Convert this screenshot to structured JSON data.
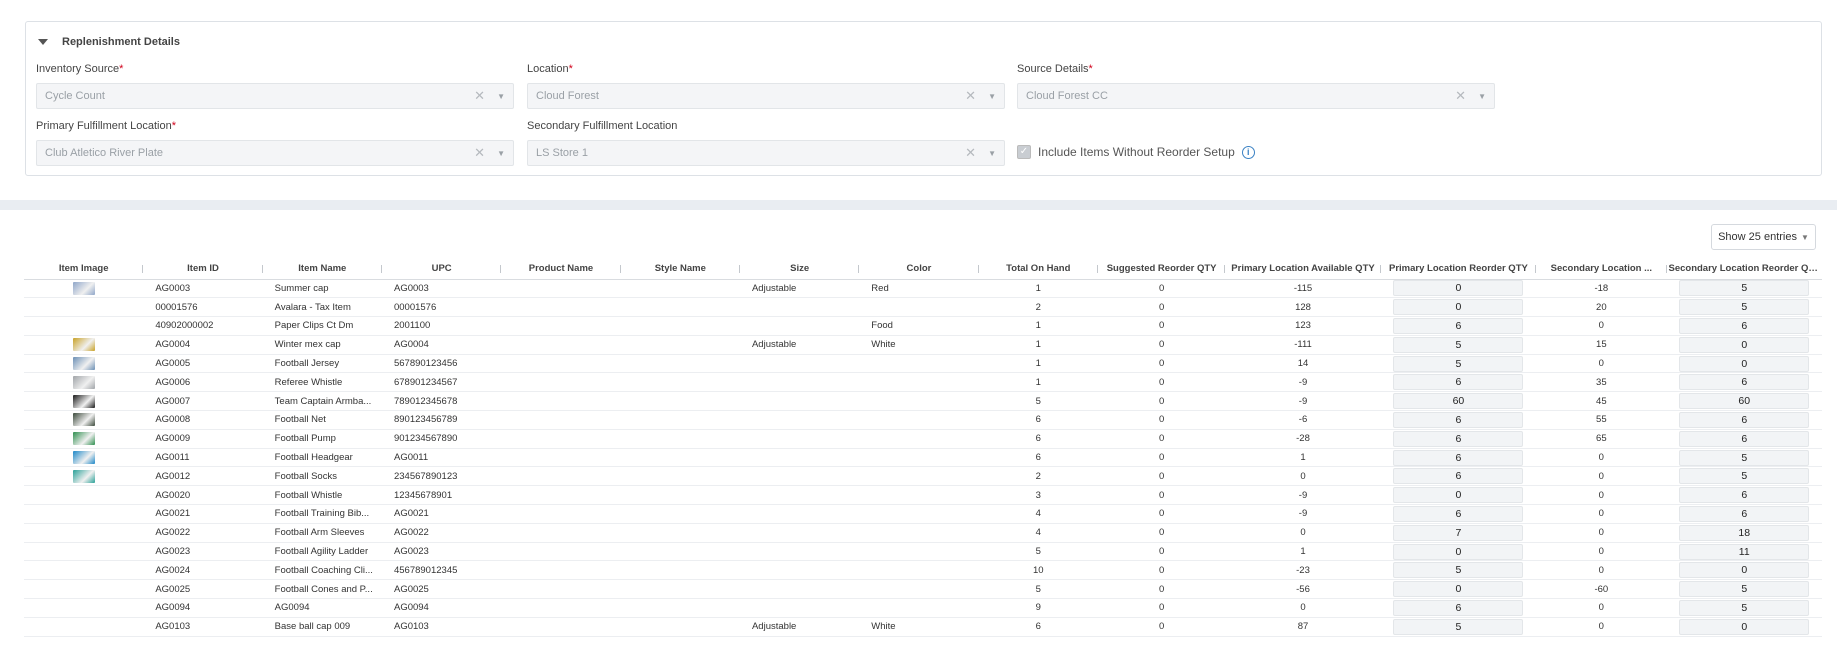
{
  "panel": {
    "title": "Replenishment Details",
    "inventory_source": {
      "label": "Inventory Source",
      "value": "Cycle Count"
    },
    "location": {
      "label": "Location",
      "value": "Cloud Forest"
    },
    "source_details": {
      "label": "Source Details",
      "value": "Cloud Forest CC"
    },
    "primary_location": {
      "label": "Primary Fulfillment Location",
      "value": "Club Atletico River Plate"
    },
    "secondary_location": {
      "label": "Secondary Fulfillment Location",
      "value": "LS Store 1"
    },
    "include_items": {
      "label": "Include Items Without Reorder Setup",
      "checked": true
    },
    "required_mark": "*"
  },
  "table": {
    "entries_label": "Show 25 entries",
    "columns": [
      "Item Image",
      "Item ID",
      "Item Name",
      "UPC",
      "Product Name",
      "Style Name",
      "Size",
      "Color",
      "Total On Hand",
      "Suggested Reorder QTY",
      "Primary Location Available QTY",
      "Primary Location Reorder QTY",
      "Secondary Location ...",
      "Secondary Location Reorder QTY"
    ],
    "rows": [
      {
        "image": "summer-cap",
        "color_swatch": "#8fa6c9",
        "item_id": "AG0003",
        "item_name": "Summer cap",
        "upc": "AG0003",
        "product_name": "",
        "style_name": "",
        "size": "Adjustable",
        "color": "Red",
        "total": "1",
        "suggested": "0",
        "primary_avail": "-115",
        "primary_reorder": "0",
        "secondary_avail": "-18",
        "secondary_reorder": "5"
      },
      {
        "image": "",
        "color_swatch": "",
        "item_id": "00001576",
        "item_name": "Avalara - Tax Item",
        "upc": "00001576",
        "product_name": "",
        "style_name": "",
        "size": "",
        "color": "",
        "total": "2",
        "suggested": "0",
        "primary_avail": "128",
        "primary_reorder": "0",
        "secondary_avail": "20",
        "secondary_reorder": "5"
      },
      {
        "image": "",
        "color_swatch": "",
        "item_id": "40902000002",
        "item_name": "Paper Clips Ct Dm",
        "upc": "2001100",
        "product_name": "",
        "style_name": "",
        "size": "",
        "color": "Food",
        "total": "1",
        "suggested": "0",
        "primary_avail": "123",
        "primary_reorder": "6",
        "secondary_avail": "0",
        "secondary_reorder": "6"
      },
      {
        "image": "winter-cap",
        "color_swatch": "#c9a227",
        "item_id": "AG0004",
        "item_name": "Winter mex cap",
        "upc": "AG0004",
        "product_name": "",
        "style_name": "",
        "size": "Adjustable",
        "color": "White",
        "total": "1",
        "suggested": "0",
        "primary_avail": "-111",
        "primary_reorder": "5",
        "secondary_avail": "15",
        "secondary_reorder": "0"
      },
      {
        "image": "football-jersey",
        "color_swatch": "#6b8fb5",
        "item_id": "AG0005",
        "item_name": "Football Jersey",
        "upc": "567890123456",
        "product_name": "",
        "style_name": "",
        "size": "",
        "color": "",
        "total": "1",
        "suggested": "0",
        "primary_avail": "14",
        "primary_reorder": "5",
        "secondary_avail": "0",
        "secondary_reorder": "0"
      },
      {
        "image": "referee-whistle",
        "color_swatch": "#a0a4a8",
        "item_id": "AG0006",
        "item_name": "Referee Whistle",
        "upc": "678901234567",
        "product_name": "",
        "style_name": "",
        "size": "",
        "color": "",
        "total": "1",
        "suggested": "0",
        "primary_avail": "-9",
        "primary_reorder": "6",
        "secondary_avail": "35",
        "secondary_reorder": "6"
      },
      {
        "image": "captain-armband",
        "color_swatch": "#1a1a1a",
        "item_id": "AG0007",
        "item_name": "Team Captain Armba...",
        "upc": "789012345678",
        "product_name": "",
        "style_name": "",
        "size": "",
        "color": "",
        "total": "5",
        "suggested": "0",
        "primary_avail": "-9",
        "primary_reorder": "60",
        "secondary_avail": "45",
        "secondary_reorder": "60"
      },
      {
        "image": "football-net",
        "color_swatch": "#3c4a3c",
        "item_id": "AG0008",
        "item_name": "Football Net",
        "upc": "890123456789",
        "product_name": "",
        "style_name": "",
        "size": "",
        "color": "",
        "total": "6",
        "suggested": "0",
        "primary_avail": "-6",
        "primary_reorder": "6",
        "secondary_avail": "55",
        "secondary_reorder": "6"
      },
      {
        "image": "football-pump",
        "color_swatch": "#2f8f4f",
        "item_id": "AG0009",
        "item_name": "Football Pump",
        "upc": "901234567890",
        "product_name": "",
        "style_name": "",
        "size": "",
        "color": "",
        "total": "6",
        "suggested": "0",
        "primary_avail": "-28",
        "primary_reorder": "6",
        "secondary_avail": "65",
        "secondary_reorder": "6"
      },
      {
        "image": "football-headgear",
        "color_swatch": "#1e88c8",
        "item_id": "AG0011",
        "item_name": "Football Headgear",
        "upc": "AG0011",
        "product_name": "",
        "style_name": "",
        "size": "",
        "color": "",
        "total": "6",
        "suggested": "0",
        "primary_avail": "1",
        "primary_reorder": "6",
        "secondary_avail": "0",
        "secondary_reorder": "5"
      },
      {
        "image": "football-socks",
        "color_swatch": "#2aa198",
        "item_id": "AG0012",
        "item_name": "Football Socks",
        "upc": "234567890123",
        "product_name": "",
        "style_name": "",
        "size": "",
        "color": "",
        "total": "2",
        "suggested": "0",
        "primary_avail": "0",
        "primary_reorder": "6",
        "secondary_avail": "0",
        "secondary_reorder": "5"
      },
      {
        "image": "",
        "color_swatch": "",
        "item_id": "AG0020",
        "item_name": "Football Whistle",
        "upc": "12345678901",
        "product_name": "",
        "style_name": "",
        "size": "",
        "color": "",
        "total": "3",
        "suggested": "0",
        "primary_avail": "-9",
        "primary_reorder": "0",
        "secondary_avail": "0",
        "secondary_reorder": "6"
      },
      {
        "image": "",
        "color_swatch": "",
        "item_id": "AG0021",
        "item_name": "Football Training Bib...",
        "upc": "AG0021",
        "product_name": "",
        "style_name": "",
        "size": "",
        "color": "",
        "total": "4",
        "suggested": "0",
        "primary_avail": "-9",
        "primary_reorder": "6",
        "secondary_avail": "0",
        "secondary_reorder": "6"
      },
      {
        "image": "",
        "color_swatch": "",
        "item_id": "AG0022",
        "item_name": "Football Arm Sleeves",
        "upc": "AG0022",
        "product_name": "",
        "style_name": "",
        "size": "",
        "color": "",
        "total": "4",
        "suggested": "0",
        "primary_avail": "0",
        "primary_reorder": "7",
        "secondary_avail": "0",
        "secondary_reorder": "18"
      },
      {
        "image": "",
        "color_swatch": "",
        "item_id": "AG0023",
        "item_name": "Football Agility Ladder",
        "upc": "AG0023",
        "product_name": "",
        "style_name": "",
        "size": "",
        "color": "",
        "total": "5",
        "suggested": "0",
        "primary_avail": "1",
        "primary_reorder": "0",
        "secondary_avail": "0",
        "secondary_reorder": "11"
      },
      {
        "image": "",
        "color_swatch": "",
        "item_id": "AG0024",
        "item_name": "Football Coaching Cli...",
        "upc": "456789012345",
        "product_name": "",
        "style_name": "",
        "size": "",
        "color": "",
        "total": "10",
        "suggested": "0",
        "primary_avail": "-23",
        "primary_reorder": "5",
        "secondary_avail": "0",
        "secondary_reorder": "0"
      },
      {
        "image": "",
        "color_swatch": "",
        "item_id": "AG0025",
        "item_name": "Football Cones and P...",
        "upc": "AG0025",
        "product_name": "",
        "style_name": "",
        "size": "",
        "color": "",
        "total": "5",
        "suggested": "0",
        "primary_avail": "-56",
        "primary_reorder": "0",
        "secondary_avail": "-60",
        "secondary_reorder": "5"
      },
      {
        "image": "",
        "color_swatch": "",
        "item_id": "AG0094",
        "item_name": "AG0094",
        "upc": "AG0094",
        "product_name": "",
        "style_name": "",
        "size": "",
        "color": "",
        "total": "9",
        "suggested": "0",
        "primary_avail": "0",
        "primary_reorder": "6",
        "secondary_avail": "0",
        "secondary_reorder": "5"
      },
      {
        "image": "",
        "color_swatch": "",
        "item_id": "AG0103",
        "item_name": "Base ball cap 009",
        "upc": "AG0103",
        "product_name": "",
        "style_name": "",
        "size": "Adjustable",
        "color": "White",
        "total": "6",
        "suggested": "0",
        "primary_avail": "87",
        "primary_reorder": "5",
        "secondary_avail": "0",
        "secondary_reorder": "0"
      }
    ]
  }
}
